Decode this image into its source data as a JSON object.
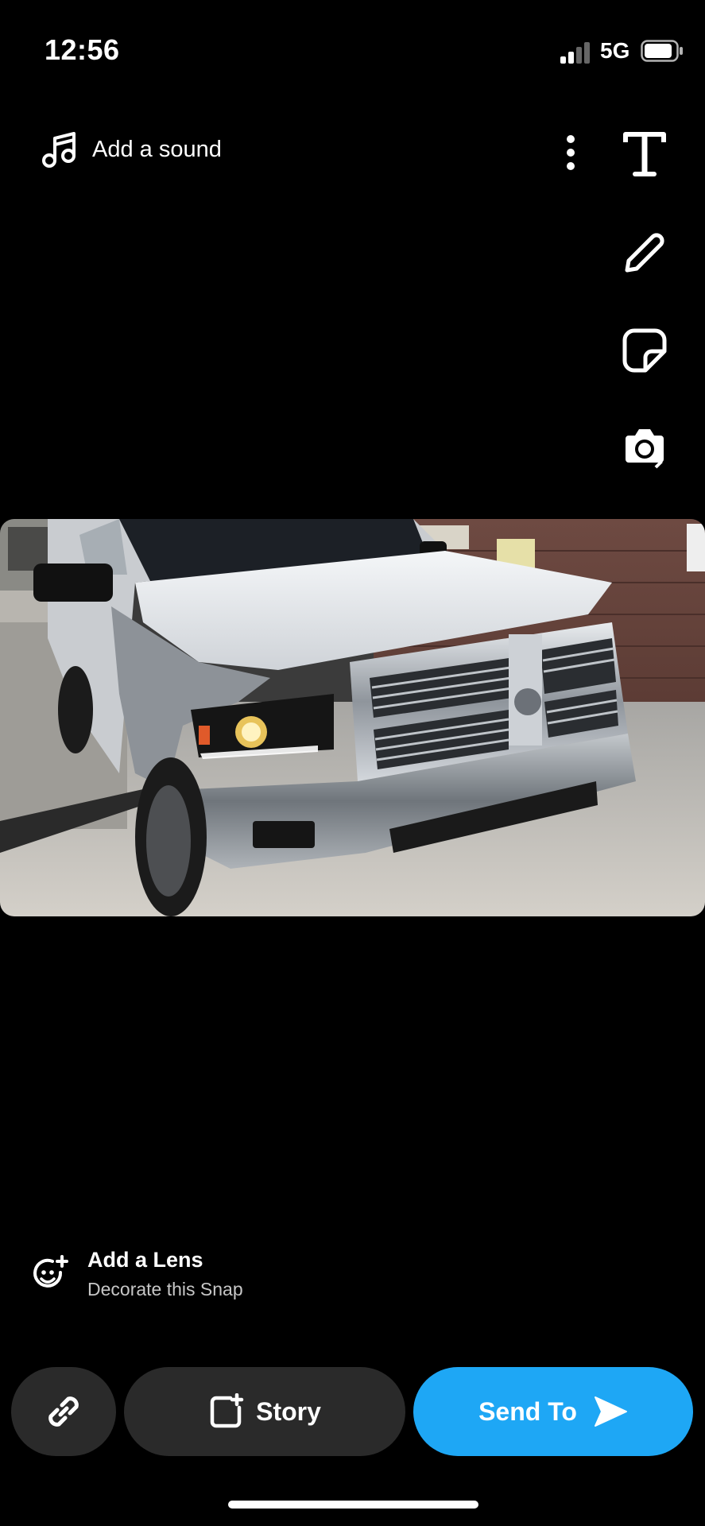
{
  "status": {
    "time": "12:56",
    "network": "5G"
  },
  "top": {
    "add_sound_label": "Add a sound"
  },
  "toolbar": {
    "icons": [
      "text-icon",
      "pencil-icon",
      "sticker-icon",
      "camera-refresh-icon",
      "chevron-down-icon"
    ]
  },
  "lens": {
    "title": "Add a Lens",
    "subtitle": "Decorate this Snap"
  },
  "actions": {
    "story_label": "Story",
    "send_label": "Send To"
  },
  "colors": {
    "background": "#000000",
    "send_button": "#1ea7f5",
    "secondary_button": "#2a2a2a"
  }
}
